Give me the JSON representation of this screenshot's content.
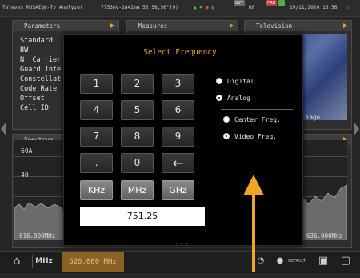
{
  "statusbar": {
    "brand": "Televes MOSAIQ6-Tv Analyzer",
    "readings": "7753mV-2842mA 53,58,56°(9)",
    "badge_out": "OUT",
    "rf_label": "RF",
    "badge_fab": "FAB",
    "datetime": "19/11/2020 13:56"
  },
  "panels": {
    "parameters": "Parameters",
    "measures": "Measures",
    "television": "Television",
    "spectrum": "Spectrum"
  },
  "params": [
    "Standard",
    "BW",
    "N. Carrier",
    "Guard Inte",
    "Constellat",
    "Code Rate",
    "Offset",
    "Cell ID"
  ],
  "tv_overlay": "iago",
  "spectrum": {
    "level_top": "60A",
    "level_mid": "40",
    "freq_left": "616.000MHz",
    "freq_right": "636.000MHz"
  },
  "dialog": {
    "title": "Select Frequency",
    "keys": [
      "1",
      "2",
      "3",
      "4",
      "5",
      "6",
      "7",
      "8",
      "9",
      ".",
      "0",
      "←"
    ],
    "units": [
      "KHz",
      "MHz",
      "GHz"
    ],
    "radios": {
      "digital": "Digital",
      "analog": "Analog",
      "center_freq": "Center Freq.",
      "video_freq": "Video Freq."
    },
    "input_value": "751.25",
    "page_dots": "• • •"
  },
  "bottombar": {
    "unit_label": "MHz",
    "frequency": "626.000 MHz",
    "default_label": "DEFAULT"
  },
  "colors": {
    "accent": "#e8a32a",
    "annotation_arrow": "#f2a523",
    "freq_chip": "#8a6224"
  }
}
